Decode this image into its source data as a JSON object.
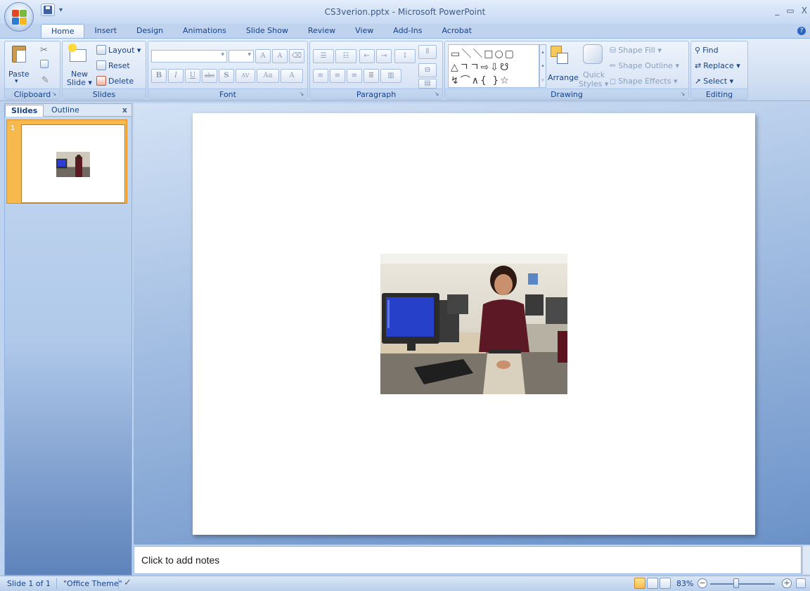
{
  "window": {
    "title": "CS3verion.pptx - Microsoft PowerPoint",
    "controls": {
      "minimize": "_",
      "restore": "▭",
      "close": "X"
    },
    "qat_more": "▾"
  },
  "tabs": [
    "Home",
    "Insert",
    "Design",
    "Animations",
    "Slide Show",
    "Review",
    "View",
    "Add-Ins",
    "Acrobat"
  ],
  "help_glyph": "?",
  "ribbon": {
    "clipboard": {
      "label": "Clipboard",
      "paste": "Paste",
      "paste_arrow": "▾"
    },
    "slides": {
      "label": "Slides",
      "new_slide_line1": "New",
      "new_slide_line2": "Slide ▾",
      "layout": "Layout ▾",
      "reset": "Reset",
      "delete": "Delete"
    },
    "font": {
      "label": "Font",
      "grow": "A",
      "shrink": "A",
      "bold": "B",
      "italic": "I",
      "underline": "U",
      "strike": "abc",
      "shadow": "S",
      "spacing": "AV",
      "case": "Aa",
      "color": "A"
    },
    "paragraph": {
      "label": "Paragraph"
    },
    "drawing": {
      "label": "Drawing",
      "arrange": "Arrange",
      "quick_styles_line1": "Quick",
      "quick_styles_line2": "Styles ▾",
      "shape_fill": "Shape Fill ▾",
      "shape_outline": "Shape Outline ▾",
      "shape_effects": "Shape Effects ▾",
      "shapes_row1": "▭＼＼□○▢",
      "shapes_row2": "△ㄱㄱ⇨⇩☋",
      "shapes_row3": "↯⌒∧{ }☆"
    },
    "editing": {
      "label": "Editing",
      "find": "Find",
      "replace": "Replace ▾",
      "select": "Select ▾"
    }
  },
  "left_pane": {
    "tab_slides": "Slides",
    "tab_outline": "Outline",
    "close": "x",
    "slide_number": "1"
  },
  "notes": {
    "placeholder": "Click to add notes"
  },
  "status": {
    "slide_info": "Slide 1 of 1",
    "theme": "\"Office Theme\"",
    "zoom": "83%",
    "zoom_out": "−",
    "zoom_in": "+"
  },
  "colors": {
    "office_orange": "#f7b94c",
    "ribbon_blue": "#15428b"
  }
}
